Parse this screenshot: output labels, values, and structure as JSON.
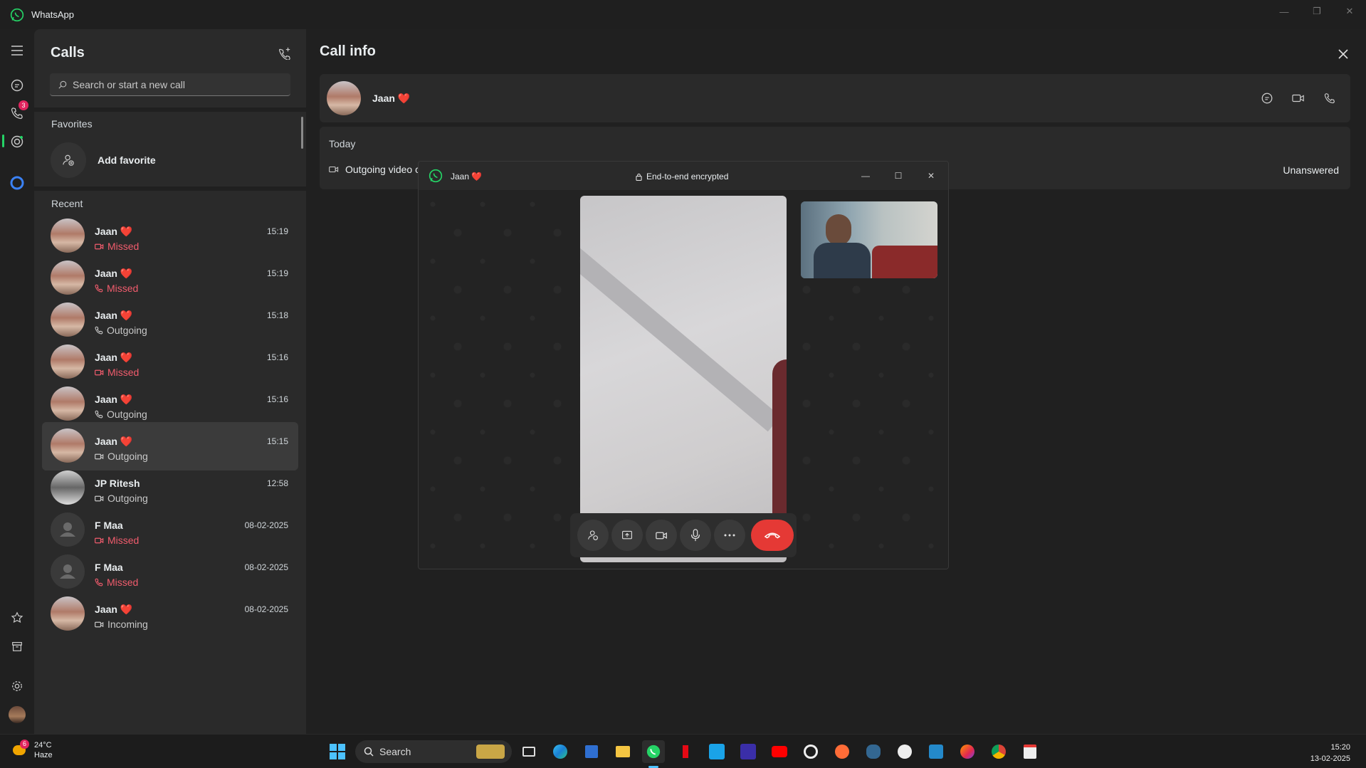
{
  "app": {
    "title": "WhatsApp"
  },
  "calls": {
    "title": "Calls",
    "search_placeholder": "Search or start a new call",
    "favorites_label": "Favorites",
    "add_favorite_label": "Add favorite",
    "recent_label": "Recent",
    "badge_count": "3",
    "items": [
      {
        "name": "Jaan ❤️",
        "status": "Missed",
        "type": "video",
        "time": "15:19"
      },
      {
        "name": "Jaan ❤️",
        "status": "Missed",
        "type": "voice",
        "time": "15:19"
      },
      {
        "name": "Jaan ❤️",
        "status": "Outgoing",
        "type": "voice",
        "time": "15:18"
      },
      {
        "name": "Jaan ❤️",
        "status": "Missed",
        "type": "video",
        "time": "15:16"
      },
      {
        "name": "Jaan ❤️",
        "status": "Outgoing",
        "type": "voice",
        "time": "15:16"
      },
      {
        "name": "Jaan ❤️",
        "status": "Outgoing",
        "type": "video",
        "time": "15:15",
        "selected": true
      },
      {
        "name": "JP Ritesh",
        "status": "Outgoing",
        "type": "video",
        "time": "12:58"
      },
      {
        "name": "F Maa",
        "status": "Missed",
        "type": "video",
        "time": "08-02-2025"
      },
      {
        "name": "F Maa",
        "status": "Missed",
        "type": "voice",
        "time": "08-02-2025"
      },
      {
        "name": "Jaan ❤️",
        "status": "Incoming",
        "type": "video",
        "time": "08-02-2025"
      }
    ]
  },
  "call_info": {
    "title": "Call info",
    "contact_name": "Jaan ❤️",
    "today_label": "Today",
    "call_type_label": "Outgoing video call",
    "call_result": "Unanswered"
  },
  "call_window": {
    "contact_name": "Jaan ❤️",
    "encryption_label": "End-to-end encrypted"
  },
  "taskbar": {
    "weather_temp": "24°C",
    "weather_desc": "Haze",
    "weather_badge": "6",
    "search_label": "Search",
    "time": "15:20",
    "date": "13-02-2025"
  },
  "colors": {
    "accent": "#25d366",
    "missed": "#f15c6d",
    "end_call": "#e53935"
  }
}
